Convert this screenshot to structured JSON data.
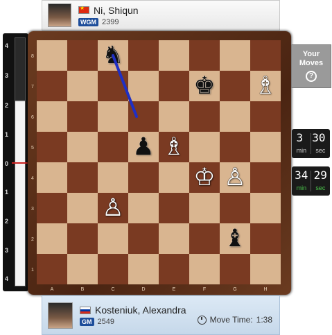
{
  "top_player": {
    "name": "Ni, Shiqun",
    "title": "WGM",
    "rating": "2399",
    "flag_icon": "china-flag-icon"
  },
  "bottom_player": {
    "name": "Kosteniuk, Alexandra",
    "title": "GM",
    "rating": "2549",
    "flag_icon": "russia-flag-icon",
    "move_time_label": "Move Time:",
    "move_time_value": "1:38"
  },
  "your_moves": {
    "label_line1": "Your",
    "label_line2": "Moves",
    "help": "?"
  },
  "clock_top": {
    "minutes": "3",
    "seconds": "30",
    "min_label": "min",
    "sec_label": "sec"
  },
  "clock_bottom": {
    "minutes": "34",
    "seconds": "29",
    "min_label": "min",
    "sec_label": "sec"
  },
  "eval_meter": {
    "marks": [
      "4",
      "3",
      "2",
      "1",
      "0",
      "1",
      "2",
      "3",
      "4"
    ]
  },
  "board": {
    "ranks": [
      "8",
      "7",
      "6",
      "5",
      "4",
      "3",
      "2",
      "1"
    ],
    "files": [
      "A",
      "B",
      "C",
      "D",
      "E",
      "F",
      "G",
      "H"
    ],
    "light_color": "#d9b590",
    "dark_color": "#7a3a22",
    "pieces": [
      {
        "square": "c8",
        "glyph": "♞",
        "color": "black",
        "name": "black-knight-icon"
      },
      {
        "square": "f7",
        "glyph": "♚",
        "color": "black",
        "name": "black-king-icon"
      },
      {
        "square": "h7",
        "glyph": "♗",
        "color": "white",
        "name": "white-bishop-icon"
      },
      {
        "square": "d5",
        "glyph": "♟",
        "color": "black",
        "name": "black-pawn-icon"
      },
      {
        "square": "e5",
        "glyph": "♗",
        "color": "white",
        "name": "white-bishop-icon"
      },
      {
        "square": "f4",
        "glyph": "♔",
        "color": "white",
        "name": "white-king-icon"
      },
      {
        "square": "g4",
        "glyph": "♙",
        "color": "white",
        "name": "white-pawn-icon"
      },
      {
        "square": "c3",
        "glyph": "♙",
        "color": "white",
        "name": "white-pawn-icon"
      },
      {
        "square": "g2",
        "glyph": "♝",
        "color": "black",
        "name": "black-bishop-icon"
      }
    ],
    "arrow": {
      "from": "c8",
      "to": "d6",
      "color": "#1f2fc4"
    }
  }
}
